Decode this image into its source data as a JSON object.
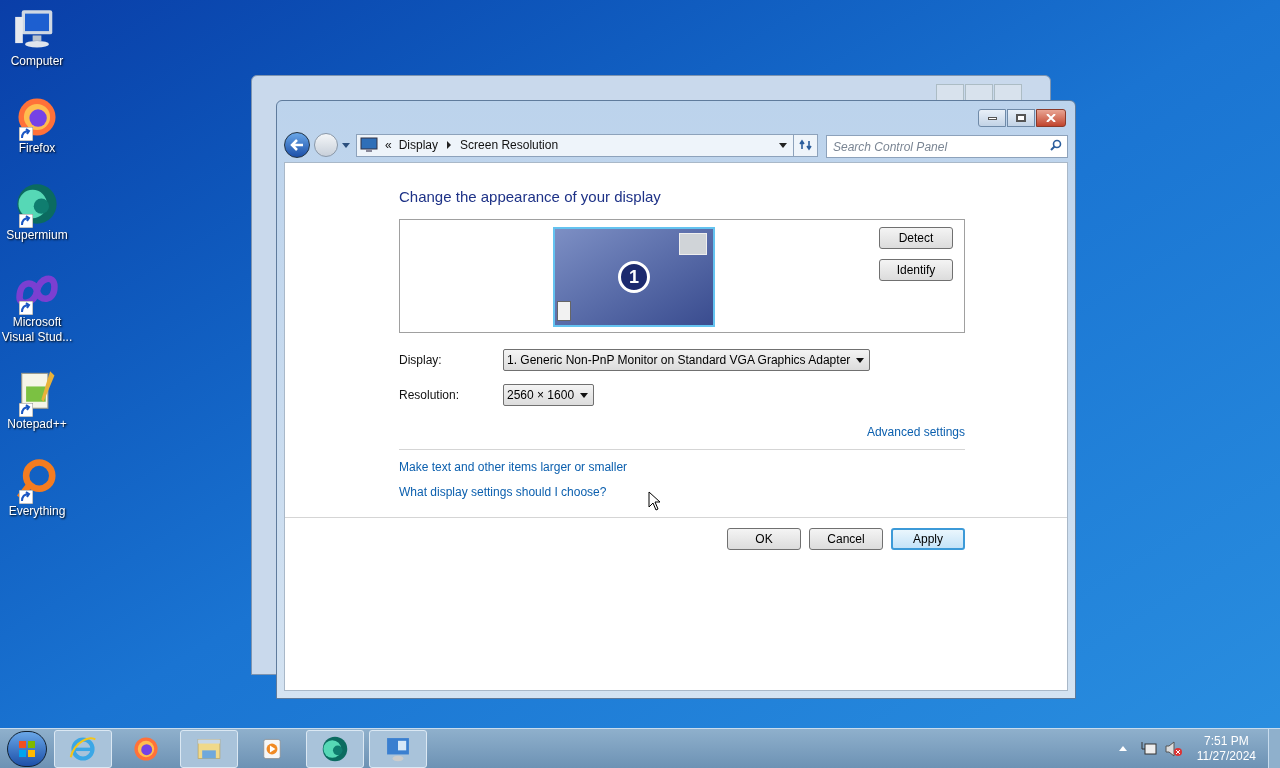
{
  "desktop_icons": [
    {
      "kind": "computer",
      "label": "Computer",
      "shortcut": false
    },
    {
      "kind": "firefox",
      "label": "Firefox",
      "shortcut": true
    },
    {
      "kind": "supermium",
      "label": "Supermium",
      "shortcut": true
    },
    {
      "kind": "vstudio",
      "label": "Microsoft Visual Stud...",
      "shortcut": true
    },
    {
      "kind": "notepad",
      "label": "Notepad++",
      "shortcut": true
    },
    {
      "kind": "everything",
      "label": "Everything",
      "shortcut": true
    }
  ],
  "window": {
    "breadcrumb": [
      "Display",
      "Screen Resolution"
    ],
    "breadcrumb_overflow": "«",
    "search": {
      "placeholder": "Search Control Panel"
    },
    "heading": "Change the appearance of your display",
    "monitor": {
      "number": "1",
      "selected": true
    },
    "detect_button": "Detect",
    "identify_button": "Identify",
    "fields": [
      {
        "label": "Display:",
        "value": "1. Generic Non-PnP Monitor on Standard VGA Graphics Adapter"
      },
      {
        "label": "Resolution:",
        "value": "2560 × 1600"
      }
    ],
    "advanced_link": "Advanced settings",
    "links": [
      "Make text and other items larger or smaller",
      "What display settings should I choose?"
    ],
    "buttons": [
      {
        "label": "OK",
        "default": false
      },
      {
        "label": "Cancel",
        "default": false
      },
      {
        "label": "Apply",
        "default": true
      }
    ]
  },
  "taskbar": {
    "items": [
      {
        "kind": "ie",
        "running": true
      },
      {
        "kind": "firefox",
        "running": false
      },
      {
        "kind": "explorer",
        "running": true
      },
      {
        "kind": "media",
        "running": false
      },
      {
        "kind": "supermium",
        "running": true
      },
      {
        "kind": "controlpanel",
        "running": true
      }
    ],
    "clock": {
      "time": "7:51 PM",
      "date": "11/27/2024"
    }
  }
}
